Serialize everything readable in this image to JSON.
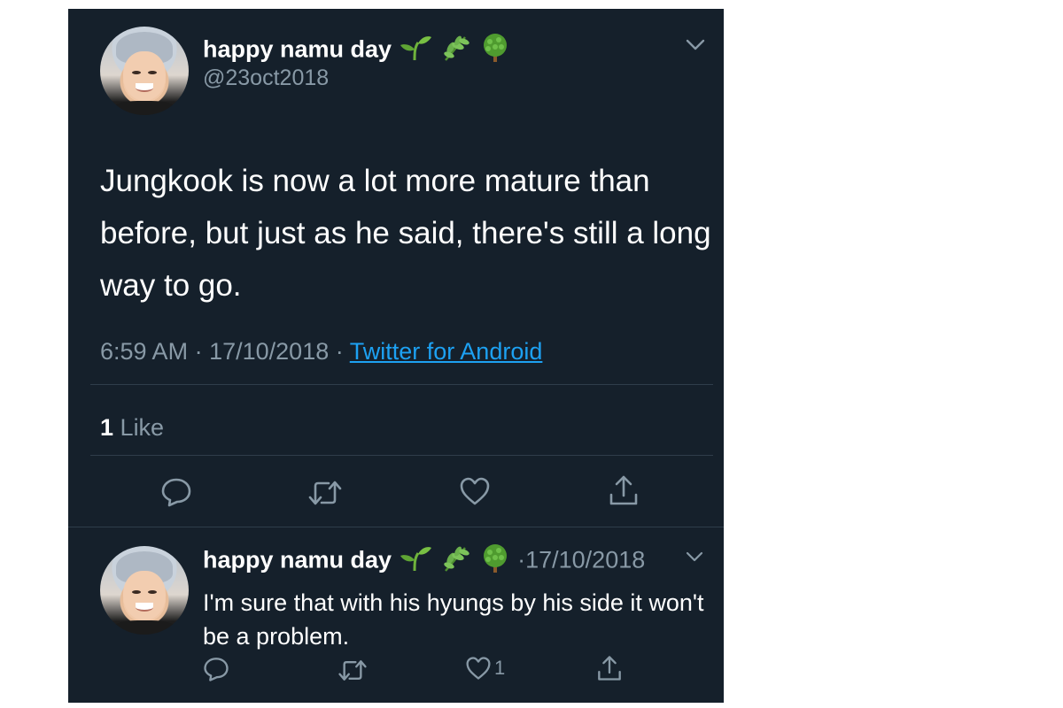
{
  "tweet": {
    "display_name": "happy namu day",
    "emojis": [
      "seedling-icon",
      "herb-icon",
      "tree-icon"
    ],
    "handle": "@23oct2018",
    "text": "Jungkook is now a lot more mature than before, but just as he said, there's still a long way to go.",
    "time": "6:59 AM",
    "date": "17/10/2018",
    "separator": "·",
    "source": "Twitter for Android",
    "likes_count": "1",
    "likes_label": "Like"
  },
  "reply": {
    "display_name": "happy namu day",
    "date": "17/10/2018",
    "text": "I'm sure that with his hyungs by his side it won't be a problem.",
    "like_count": "1"
  },
  "colors": {
    "background": "#15202b",
    "text": "#ffffff",
    "secondary": "#8899a6",
    "link": "#1da1f2",
    "divider": "#2f3d4a"
  }
}
